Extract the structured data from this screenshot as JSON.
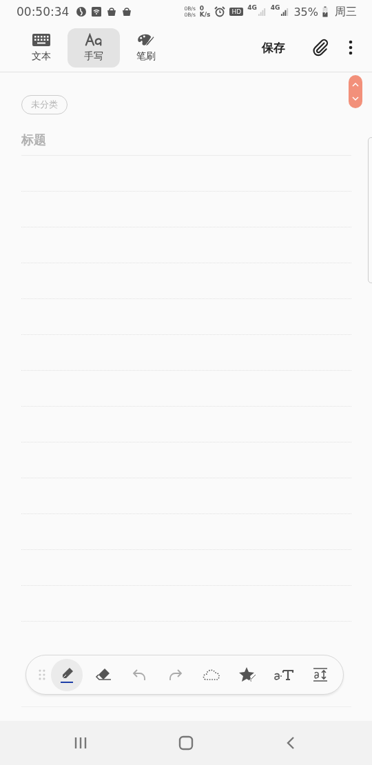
{
  "status_bar": {
    "time": "00:50:34",
    "net_up": "0B/s",
    "net_down": "0B/s",
    "speed_value": "0",
    "speed_unit": "K/s",
    "hd": "HD",
    "sim1": "4G",
    "sim2": "4G",
    "battery": "35%",
    "day": "周三"
  },
  "mode_tabs": [
    {
      "kind": "keyboard",
      "label": "文本",
      "selected": false
    },
    {
      "kind": "handwriting",
      "label": "手写",
      "selected": true
    },
    {
      "kind": "brush",
      "label": "笔刷",
      "selected": false
    }
  ],
  "save_button": "保存",
  "note": {
    "category": "未分类",
    "title_placeholder": "标题"
  },
  "pen_toolbar": [
    {
      "kind": "pen",
      "selected": true,
      "disabled": false,
      "color": "#1e3fa8"
    },
    {
      "kind": "eraser",
      "selected": false,
      "disabled": false
    },
    {
      "kind": "undo",
      "selected": false,
      "disabled": true
    },
    {
      "kind": "redo",
      "selected": false,
      "disabled": true
    },
    {
      "kind": "lasso",
      "selected": false,
      "disabled": false
    },
    {
      "kind": "shape",
      "selected": false,
      "disabled": false
    },
    {
      "kind": "convert",
      "selected": false,
      "disabled": false
    },
    {
      "kind": "spacing",
      "selected": false,
      "disabled": false
    }
  ]
}
